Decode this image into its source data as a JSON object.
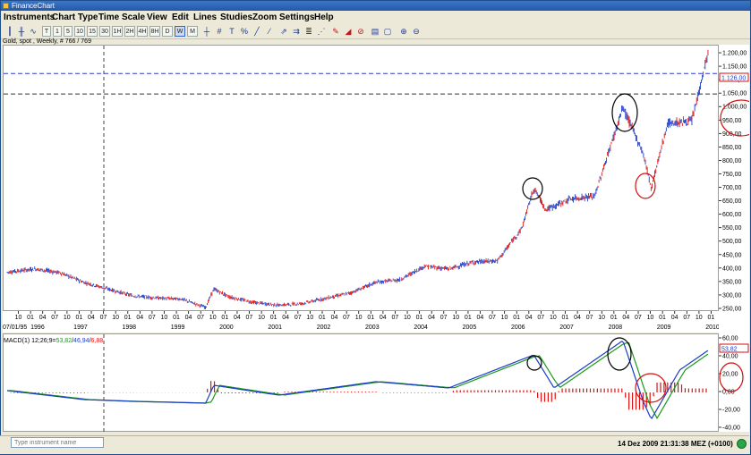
{
  "window": {
    "title": "FinanceChart"
  },
  "menu": [
    "Instruments",
    "Chart Type",
    "Time Scale",
    "View",
    "Edit",
    "Lines",
    "Studies",
    "Zoom",
    "Settings",
    "Help"
  ],
  "toolbar": {
    "timeframes": [
      "T",
      "1",
      "5",
      "10",
      "15",
      "30",
      "1H",
      "2H",
      "4H",
      "8H",
      "D",
      "W",
      "M"
    ],
    "selected": "W"
  },
  "instrument": {
    "label": "Gold, spot , Weekly, # 766 / 769"
  },
  "price_axis": {
    "ticks": [
      "1.200,00",
      "1.150,00",
      "1.100,00",
      "1.050,00",
      "1.000,00",
      "950,00",
      "900,00",
      "850,00",
      "800,00",
      "750,00",
      "700,00",
      "650,00",
      "600,00",
      "550,00",
      "500,00",
      "450,00",
      "400,00",
      "350,00",
      "300,00",
      "250,00"
    ],
    "current_value": "1.126,00",
    "current_color": "#1a3cc8"
  },
  "macd": {
    "label_prefix": "MACD(1) 12;26;9=",
    "value_signal": "53,82",
    "value_macd": "46,94",
    "value_hist": "6,88",
    "ticks": [
      "60,00",
      "40,00",
      "20,00",
      "0,00",
      "-20,00",
      "-40,00"
    ],
    "current_value": "53,82",
    "colors": {
      "signal": "#1a9a1a",
      "macd": "#1a3cc8",
      "hist": "#e01010"
    }
  },
  "time_axis": {
    "first_label": "07/01/95",
    "start_year_label": "1996",
    "month_labels": [
      "04",
      "07",
      "10",
      "01"
    ],
    "years": [
      "1997",
      "1998",
      "1999",
      "2000",
      "2001",
      "2002",
      "2003",
      "2004",
      "2005",
      "2006",
      "2007",
      "2008",
      "2009",
      "2010"
    ]
  },
  "status": {
    "search_placeholder": "Type instrument name",
    "datetime": "14 Dez 2009 21:31:38  MEZ (+0100)"
  },
  "chart_data": {
    "type": "line",
    "series": [
      {
        "name": "Gold, spot",
        "kind": "price",
        "x": [
          "1995-07",
          "1996-02",
          "1996-08",
          "1997-02",
          "1997-08",
          "1998-02",
          "1998-08",
          "1999-02",
          "1999-08",
          "1999-10",
          "2000-02",
          "2000-08",
          "2001-02",
          "2001-08",
          "2002-02",
          "2002-08",
          "2003-02",
          "2003-08",
          "2004-02",
          "2004-08",
          "2005-02",
          "2005-08",
          "2006-02",
          "2006-05",
          "2006-08",
          "2007-02",
          "2007-08",
          "2008-03",
          "2008-08",
          "2008-10",
          "2009-02",
          "2009-08",
          "2009-12"
        ],
        "y": [
          388,
          400,
          386,
          350,
          325,
          300,
          292,
          288,
          257,
          325,
          295,
          275,
          265,
          272,
          292,
          312,
          350,
          360,
          410,
          400,
          425,
          430,
          550,
          700,
          620,
          660,
          670,
          1000,
          830,
          700,
          940,
          950,
          1200
        ]
      },
      {
        "name": "MACD(1) 12;26;9",
        "kind": "macd",
        "x": [
          "1995-07",
          "1997-02",
          "1998-02",
          "1999-08",
          "1999-10",
          "2001-02",
          "2003-02",
          "2004-08",
          "2006-05",
          "2006-10",
          "2008-03",
          "2008-08",
          "2008-10",
          "2009-05",
          "2009-12"
        ],
        "y": [
          2,
          -8,
          -10,
          -12,
          8,
          -3,
          12,
          5,
          42,
          5,
          58,
          -10,
          -30,
          25,
          46.94
        ]
      }
    ],
    "price_ylim": [
      240,
      1230
    ],
    "macd_ylim": [
      -45,
      65
    ],
    "reference_lines": [
      1126,
      1050
    ],
    "legend": "none",
    "grid": false
  }
}
